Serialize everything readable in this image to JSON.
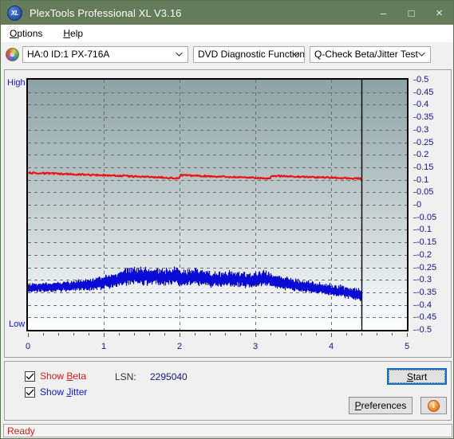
{
  "window": {
    "title": "PlexTools Professional XL V3.16",
    "app_icon": "xl-logo-icon",
    "minimize_label": "–",
    "maximize_label": "□",
    "close_label": "×",
    "titlebar_color": "#647c5a"
  },
  "menubar": {
    "items": [
      {
        "label": "Options",
        "mnemonic": "O"
      },
      {
        "label": "Help",
        "mnemonic": "H"
      }
    ]
  },
  "toolbar": {
    "drive_icon": "optical-disc-icon",
    "drive_select": "HA:0 ID:1  PX-716A",
    "function_select": "DVD Diagnostic Functions",
    "test_select": "Q-Check Beta/Jitter Test"
  },
  "chart_labels": {
    "high": "High",
    "low": "Low"
  },
  "controls": {
    "show_beta_label": "Show Beta",
    "show_beta_mnemonic": "B",
    "show_beta_checked": true,
    "show_beta_color": "#e01a1a",
    "show_jitter_label": "Show Jitter",
    "show_jitter_mnemonic": "J",
    "show_jitter_checked": true,
    "show_jitter_color": "#1515d0",
    "lsn_label": "LSN:",
    "lsn_value": "2295040",
    "start_label": "Start",
    "start_mnemonic": "S",
    "preferences_label": "Preferences",
    "preferences_mnemonic": "P",
    "info_label": "i",
    "info_icon": "info-icon"
  },
  "statusbar": {
    "text": "Ready",
    "color": "#e01a1a"
  },
  "chart_data": {
    "type": "line",
    "title": "Q-Check Beta/Jitter Test",
    "xlabel": "",
    "ylabel": "",
    "xlim": [
      0,
      5
    ],
    "ylim": [
      -0.5,
      0.5
    ],
    "xticks": [
      0,
      1,
      2,
      3,
      4,
      5
    ],
    "yticks": [
      0.5,
      0.45,
      0.4,
      0.35,
      0.3,
      0.25,
      0.2,
      0.15,
      0.1,
      0.05,
      0,
      -0.05,
      -0.1,
      -0.15,
      -0.2,
      -0.25,
      -0.3,
      -0.35,
      -0.4,
      -0.45,
      -0.5
    ],
    "ytick_labels": [
      "0.5",
      "0.45",
      "0.4",
      "0.35",
      "0.3",
      "0.25",
      "0.2",
      "0.15",
      "0.1",
      "0.05",
      "0",
      "-0.05",
      "-0.1",
      "-0.15",
      "-0.2",
      "-0.25",
      "-0.3",
      "-0.35",
      "-0.4",
      "-0.45",
      "-0.5"
    ],
    "grid": true,
    "grid_style": "dashed",
    "grid_color": "#707070",
    "axis_top_label": "High",
    "axis_bottom_label": "Low",
    "data_end_x": 4.4,
    "cursor_line_x": 4.4,
    "background_gradient": [
      "#8ba3a6",
      "#ffffff"
    ],
    "series": [
      {
        "name": "Beta",
        "color": "#ee1111",
        "kind": "line",
        "x": [
          0.0,
          0.1,
          0.2,
          0.3,
          0.4,
          0.5,
          0.6,
          0.7,
          0.8,
          0.9,
          1.0,
          1.1,
          1.2,
          1.3,
          1.4,
          1.5,
          1.6,
          1.7,
          1.8,
          1.9,
          1.99,
          2.01,
          2.1,
          2.2,
          2.3,
          2.4,
          2.5,
          2.6,
          2.7,
          2.8,
          2.9,
          3.0,
          3.1,
          3.19,
          3.21,
          3.3,
          3.4,
          3.5,
          3.6,
          3.7,
          3.8,
          3.9,
          4.0,
          4.1,
          4.2,
          4.3,
          4.4
        ],
        "values": [
          0.128,
          0.127,
          0.126,
          0.125,
          0.124,
          0.123,
          0.122,
          0.121,
          0.12,
          0.119,
          0.118,
          0.117,
          0.116,
          0.115,
          0.113,
          0.112,
          0.111,
          0.11,
          0.109,
          0.107,
          0.105,
          0.118,
          0.117,
          0.116,
          0.115,
          0.114,
          0.113,
          0.112,
          0.111,
          0.11,
          0.109,
          0.108,
          0.106,
          0.103,
          0.116,
          0.115,
          0.114,
          0.113,
          0.112,
          0.111,
          0.11,
          0.109,
          0.108,
          0.107,
          0.106,
          0.105,
          0.104
        ],
        "noise_amplitude": 0.006
      },
      {
        "name": "Jitter",
        "color": "#0b0bd6",
        "kind": "band",
        "x": [
          0.0,
          0.2,
          0.4,
          0.6,
          0.8,
          1.0,
          1.2,
          1.3,
          1.4,
          1.5,
          1.6,
          1.7,
          1.8,
          1.9,
          2.0,
          2.1,
          2.2,
          2.3,
          2.4,
          2.5,
          2.6,
          2.7,
          2.8,
          2.9,
          3.0,
          3.1,
          3.2,
          3.3,
          3.4,
          3.5,
          3.6,
          3.7,
          3.8,
          3.9,
          4.0,
          4.1,
          4.2,
          4.3,
          4.4
        ],
        "center": [
          -0.335,
          -0.333,
          -0.33,
          -0.327,
          -0.322,
          -0.313,
          -0.3,
          -0.292,
          -0.288,
          -0.288,
          -0.291,
          -0.289,
          -0.292,
          -0.286,
          -0.293,
          -0.297,
          -0.29,
          -0.296,
          -0.3,
          -0.303,
          -0.3,
          -0.297,
          -0.302,
          -0.305,
          -0.303,
          -0.297,
          -0.302,
          -0.31,
          -0.317,
          -0.322,
          -0.327,
          -0.332,
          -0.336,
          -0.34,
          -0.343,
          -0.347,
          -0.352,
          -0.358,
          -0.366
        ],
        "spread": [
          0.02,
          0.021,
          0.022,
          0.024,
          0.026,
          0.03,
          0.034,
          0.038,
          0.038,
          0.04,
          0.038,
          0.036,
          0.037,
          0.036,
          0.04,
          0.036,
          0.036,
          0.034,
          0.034,
          0.033,
          0.033,
          0.034,
          0.034,
          0.032,
          0.033,
          0.038,
          0.033,
          0.03,
          0.029,
          0.028,
          0.028,
          0.027,
          0.027,
          0.026,
          0.026,
          0.026,
          0.026,
          0.026,
          0.028
        ]
      }
    ]
  }
}
